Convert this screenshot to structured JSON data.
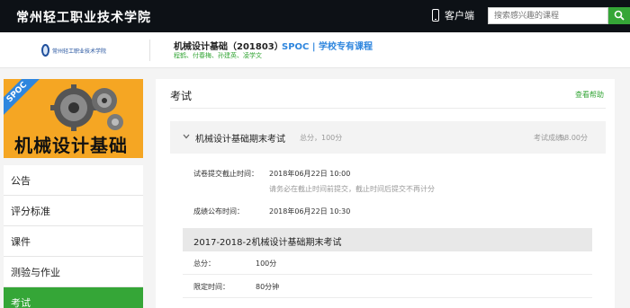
{
  "topbar": {
    "school_name": "常州轻工职业技术学院",
    "client_label": "客户端",
    "search_placeholder": "搜索感兴趣的课程",
    "accent_color": "#35a637"
  },
  "course": {
    "logo_text": "常州轻工职业技术学院",
    "title": "机械设计基础（201803）",
    "teachers": "程鹤、付春梅、孙建英、凌学文",
    "tag": "SPOC | 学校专有课程",
    "cover_badge": "SPOC",
    "cover_title": "机械设计基础"
  },
  "sidebar": {
    "items": [
      {
        "label": "公告"
      },
      {
        "label": "评分标准"
      },
      {
        "label": "课件"
      },
      {
        "label": "测验与作业"
      },
      {
        "label": "考试"
      }
    ],
    "active_index": 4
  },
  "main": {
    "title": "考试",
    "help_link": "查看帮助",
    "exam": {
      "name": "机械设计基础期末考试",
      "meta": "总分，100分",
      "score_label": "考试成绩，",
      "score": "98.00分",
      "deadline_label": "试卷提交截止时间：",
      "deadline_value": "2018年06月22日  10:00",
      "deadline_note": "请务必在截止时间前提交，截止时间后提交不再计分",
      "publish_label": "成绩公布时间：",
      "publish_value": "2018年06月22日  10:30"
    },
    "paper": {
      "title": "2017-2018-2机械设计基础期末考试",
      "rows": [
        {
          "label": "总分：",
          "value": "100分"
        },
        {
          "label": "限定时间：",
          "value": "80分钟"
        }
      ]
    }
  }
}
